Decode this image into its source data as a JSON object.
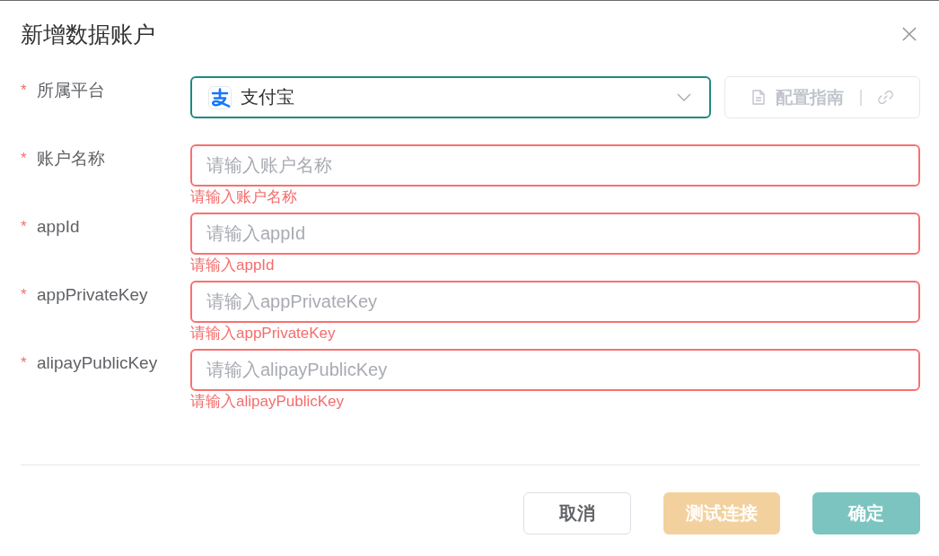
{
  "dialog": {
    "title": "新增数据账户"
  },
  "fields": [
    {
      "kind": "select",
      "required_mark": "*",
      "label": "所属平台",
      "value": "支付宝",
      "focused": true,
      "guide_button": {
        "label": "配置指南",
        "disabled": true
      }
    },
    {
      "kind": "input",
      "required_mark": "*",
      "label": "账户名称",
      "placeholder": "请输入账户名称",
      "focused": false,
      "error": "请输入账户名称"
    },
    {
      "kind": "input",
      "required_mark": "*",
      "label": "appId",
      "placeholder": "请输入appId",
      "focused": false,
      "error": "请输入appId"
    },
    {
      "kind": "input",
      "required_mark": "*",
      "label": "appPrivateKey",
      "placeholder": "请输入appPrivateKey",
      "focused": false,
      "error": "请输入appPrivateKey"
    },
    {
      "kind": "input",
      "required_mark": "*",
      "label": "alipayPublicKey",
      "placeholder": "请输入alipayPublicKey",
      "focused": false,
      "error": "请输入alipayPublicKey"
    }
  ],
  "buttons": [
    {
      "label": "取消",
      "kind": "default",
      "disabled": false
    },
    {
      "label": "测试连接",
      "kind": "warning",
      "disabled": true
    },
    {
      "label": "确定",
      "kind": "primary",
      "disabled": true
    }
  ]
}
